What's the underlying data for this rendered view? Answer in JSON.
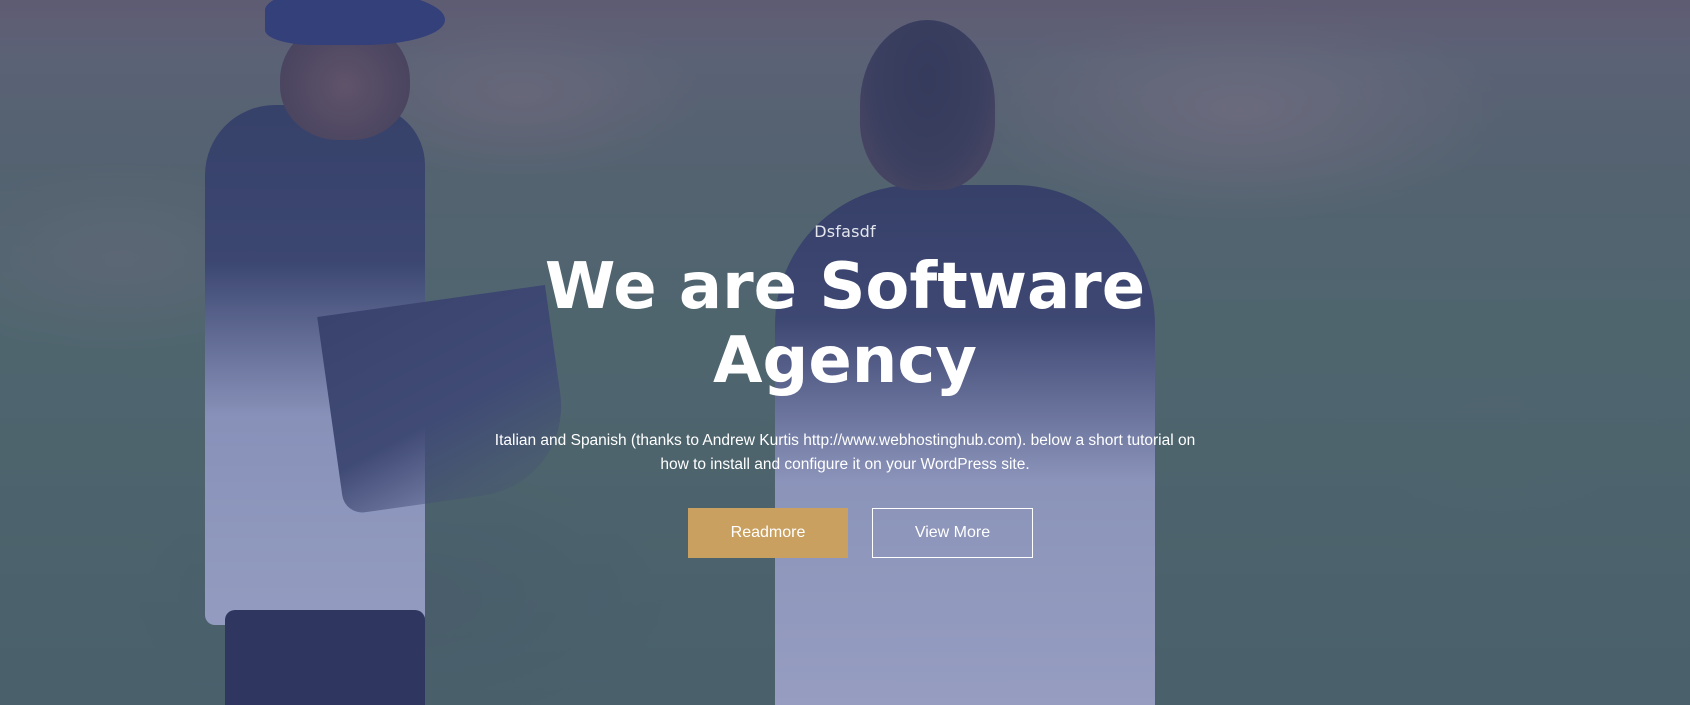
{
  "hero": {
    "subtitle": "Dsfasdf",
    "title": "We are Software Agency",
    "description": "Italian and Spanish (thanks to Andrew Kurtis http://www.webhostinghub.com). below a short tutorial on how to install and configure it on your WordPress site.",
    "buttons": {
      "readmore_label": "Readmore",
      "viewmore_label": "View More"
    }
  },
  "colors": {
    "overlay": "#46529180",
    "accent": "#c9a060",
    "text": "#ffffff"
  }
}
